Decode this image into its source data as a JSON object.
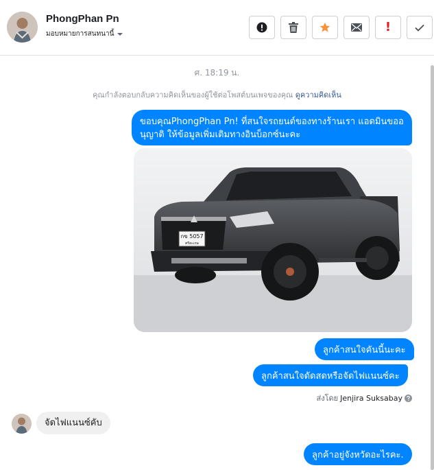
{
  "header": {
    "contact_name": "PhongPhan Pn",
    "assign_label": "มอบหมายการสนทนานี้",
    "actions": [
      {
        "icon": "alert-circle-icon",
        "label": "Mark as spam"
      },
      {
        "icon": "trash-icon",
        "label": "Delete"
      },
      {
        "icon": "star-icon",
        "label": "Star"
      },
      {
        "icon": "envelope-icon",
        "label": "Mark as unread"
      },
      {
        "icon": "exclamation-icon",
        "label": "Follow up",
        "glyph": "!"
      },
      {
        "icon": "check-icon",
        "label": "Done"
      }
    ]
  },
  "thread": {
    "timestamp": "ศ. 18:19 น.",
    "reply_notice_prefix": "คุณกำลังตอบกลับความคิดเห็นของผู้ใช้ต่อโพสต์บนเพจของคุณ",
    "reply_notice_link": "ดูความคิดเห็น",
    "messages": {
      "m1": "ขอบคุณPhongPhan Pn! ที่สนใจรถยนต์ของทางร้านเรา แอดมินขออนุญาติ ให้ข้อมูลเพิ่มเติมทางอินบ็อกซ์นะคะ",
      "m2": "ลูกค้าสนใจคันนี้นะคะ",
      "m3": "ลูกค้าสนใจดัดสดหรือจัดไฟแนนซ์คะ",
      "m4": "จัดไฟแนนซ์คับ",
      "m5": "ลูกค้าอยู่จังหวัดอะไรคะ."
    },
    "photo": {
      "plate_line1": "กข 5057",
      "plate_line2": "ศรีสะเกษ"
    },
    "sent_by_prefix": "ส่งโดย",
    "sent_by_agent": "Jenjira Suksabay"
  },
  "colors": {
    "bubble_out": "#0084ff",
    "bubble_in": "#f1f0f0",
    "star": "#f7923a",
    "follow_up": "#e02020",
    "link": "#385898"
  }
}
